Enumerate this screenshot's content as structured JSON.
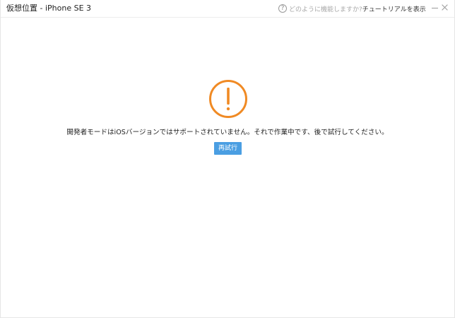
{
  "window": {
    "title": "仮想位置 - iPhone SE 3"
  },
  "header": {
    "help_icon": "question-circle-icon",
    "help_glyph": "?",
    "help_question": "どのように機能しますか?",
    "tutorial_link": "チュートリアルを表示"
  },
  "colors": {
    "warning": "#f08a24",
    "button": "#4a9ee2"
  },
  "main": {
    "warning_icon": "exclamation-circle-icon",
    "message": "開発者モードはiOSバージョンではサポートされていません。それで作業中です、後で試行してください。",
    "retry_label": "再試行"
  }
}
